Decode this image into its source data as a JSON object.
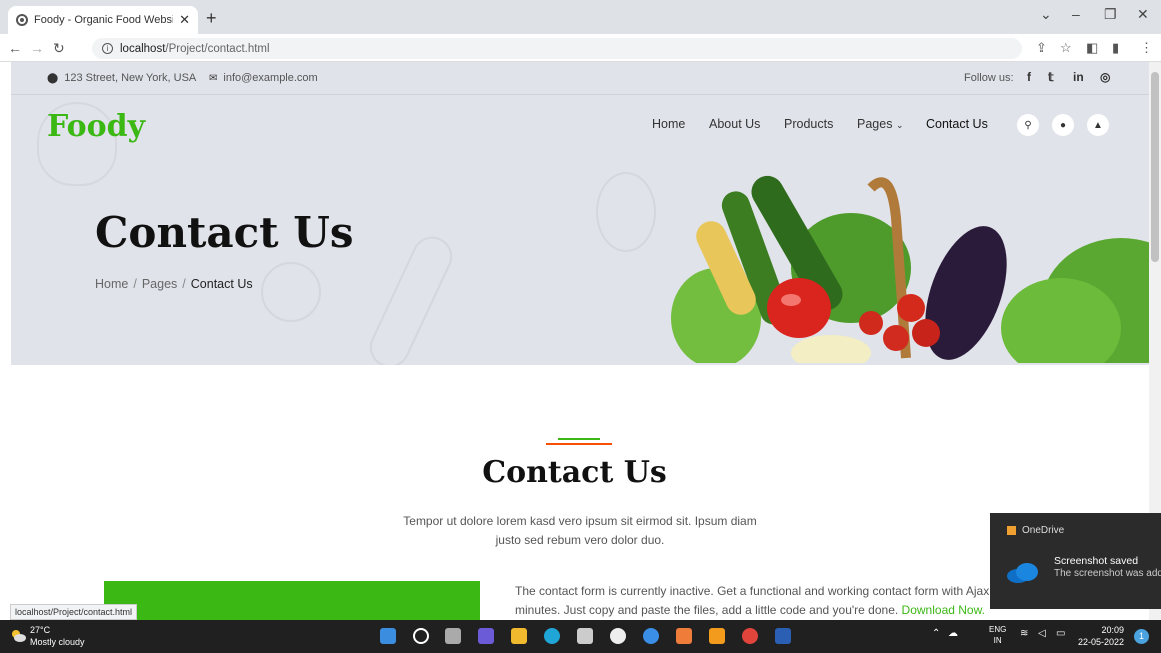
{
  "browser": {
    "tab_title": "Foody - Organic Food Website Te",
    "new_tab": "+",
    "url_host": "localhost",
    "url_path": "/Project/contact.html",
    "status_url": "localhost/Project/contact.html"
  },
  "topbar": {
    "address": "123 Street, New York, USA",
    "email": "info@example.com",
    "follow_label": "Follow us:",
    "social": [
      "f",
      "t",
      "in",
      "ig"
    ]
  },
  "brand": {
    "logo": "Foody"
  },
  "nav": {
    "items": [
      {
        "label": "Home"
      },
      {
        "label": "About Us"
      },
      {
        "label": "Products"
      },
      {
        "label": "Pages"
      },
      {
        "label": "Contact Us"
      }
    ]
  },
  "hero": {
    "title": "Contact Us",
    "breadcrumb": [
      "Home",
      "Pages",
      "Contact Us"
    ]
  },
  "section": {
    "title": "Contact Us",
    "subtitle": "Tempor ut dolore lorem kasd vero ipsum sit eirmod sit. Ipsum diam justo sed rebum vero dolor duo.",
    "note": "The contact form is currently inactive. Get a functional and working contact form with Ajax & PHP in a few minutes. Just copy and paste the files, add a little code and you're done.",
    "note_link": "Download Now."
  },
  "toast": {
    "app": "OneDrive",
    "title": "Screenshot saved",
    "body": "The screenshot was added to your OneDrive."
  },
  "taskbar": {
    "temp": "27°C",
    "weather": "Mostly cloudy",
    "lang1": "ENG",
    "lang2": "IN",
    "time": "20:09",
    "date": "22-05-2022",
    "notif_count": "1"
  },
  "colors": {
    "brand_green": "#3cb815",
    "accent_orange": "#f65005",
    "hero_bg": "#e0e3ea"
  }
}
